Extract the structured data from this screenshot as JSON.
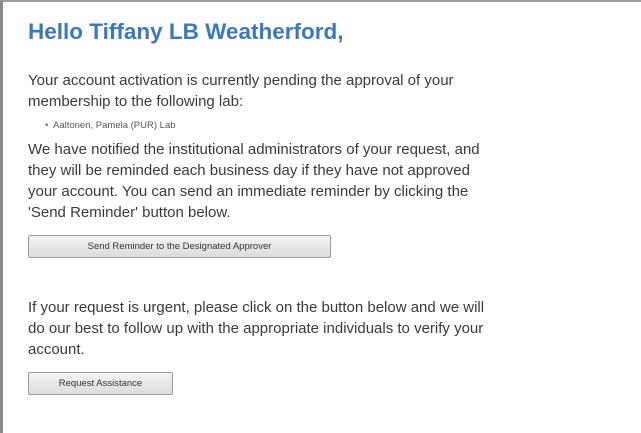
{
  "greeting": "Hello Tiffany LB Weatherford,",
  "pending_message": {
    "line1": "Your account activation is currently pending the approval of your",
    "line2": "membership to the following lab:"
  },
  "labs": [
    "Aaltonen, Pamela (PUR) Lab"
  ],
  "notified_message": {
    "line1": "We have notified the institutional administrators of your request, and",
    "line2": "they will be reminded each business day if they have not approved",
    "line3": "your account. You can send an immediate reminder by clicking the",
    "line4": "'Send Reminder' button below."
  },
  "send_reminder_label": "Send Reminder to the Designated Approver",
  "urgent_message": {
    "line1": "If your request is urgent, please click on the button below and we will",
    "line2": "do our best to follow up with the appropriate individuals to verify your",
    "line3": "account."
  },
  "request_assistance_label": "Request Assistance",
  "colors": {
    "greeting": "#3a78c3",
    "body_text": "#3a3a3a",
    "button_border": "#9d9d9d"
  }
}
